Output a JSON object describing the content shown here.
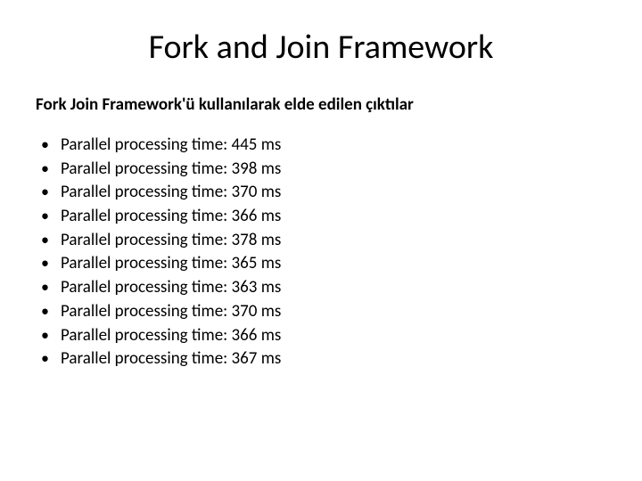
{
  "title": "Fork and Join Framework",
  "subtitle": "Fork Join Framework'ü kullanılarak elde edilen çıktılar",
  "outputs": [
    "Parallel processing time: 445 ms",
    "Parallel processing time: 398 ms",
    "Parallel processing time: 370 ms",
    "Parallel processing time: 366 ms",
    "Parallel processing time: 378 ms",
    "Parallel processing time: 365 ms",
    "Parallel processing time: 363 ms",
    "Parallel processing time: 370 ms",
    "Parallel processing time: 366 ms",
    "Parallel processing time: 367 ms"
  ]
}
